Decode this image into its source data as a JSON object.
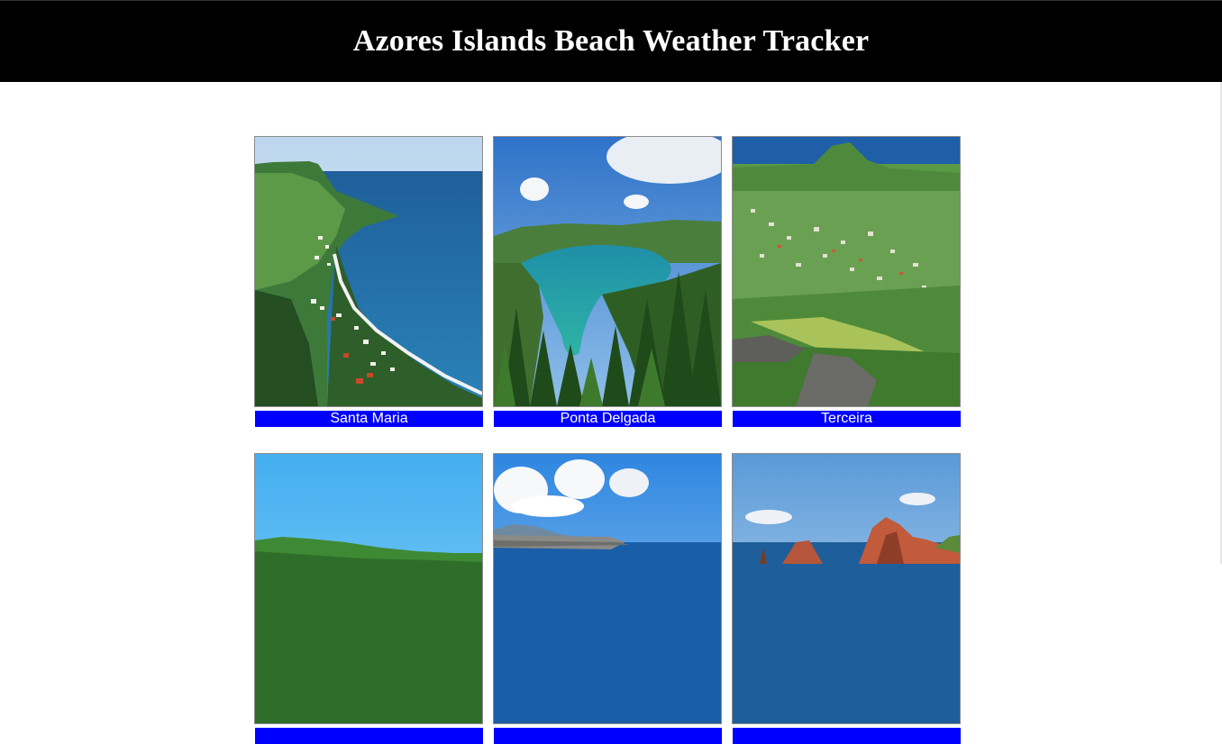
{
  "header": {
    "title": "Azores Islands Beach Weather Tracker"
  },
  "islands": [
    {
      "name": "Santa Maria"
    },
    {
      "name": "Ponta Delgada"
    },
    {
      "name": "Terceira"
    },
    {
      "name": ""
    },
    {
      "name": ""
    },
    {
      "name": ""
    }
  ],
  "colors": {
    "header_bg": "#000000",
    "header_text": "#ffffff",
    "caption_bg": "#0000ff",
    "caption_text": "#ffffff"
  }
}
